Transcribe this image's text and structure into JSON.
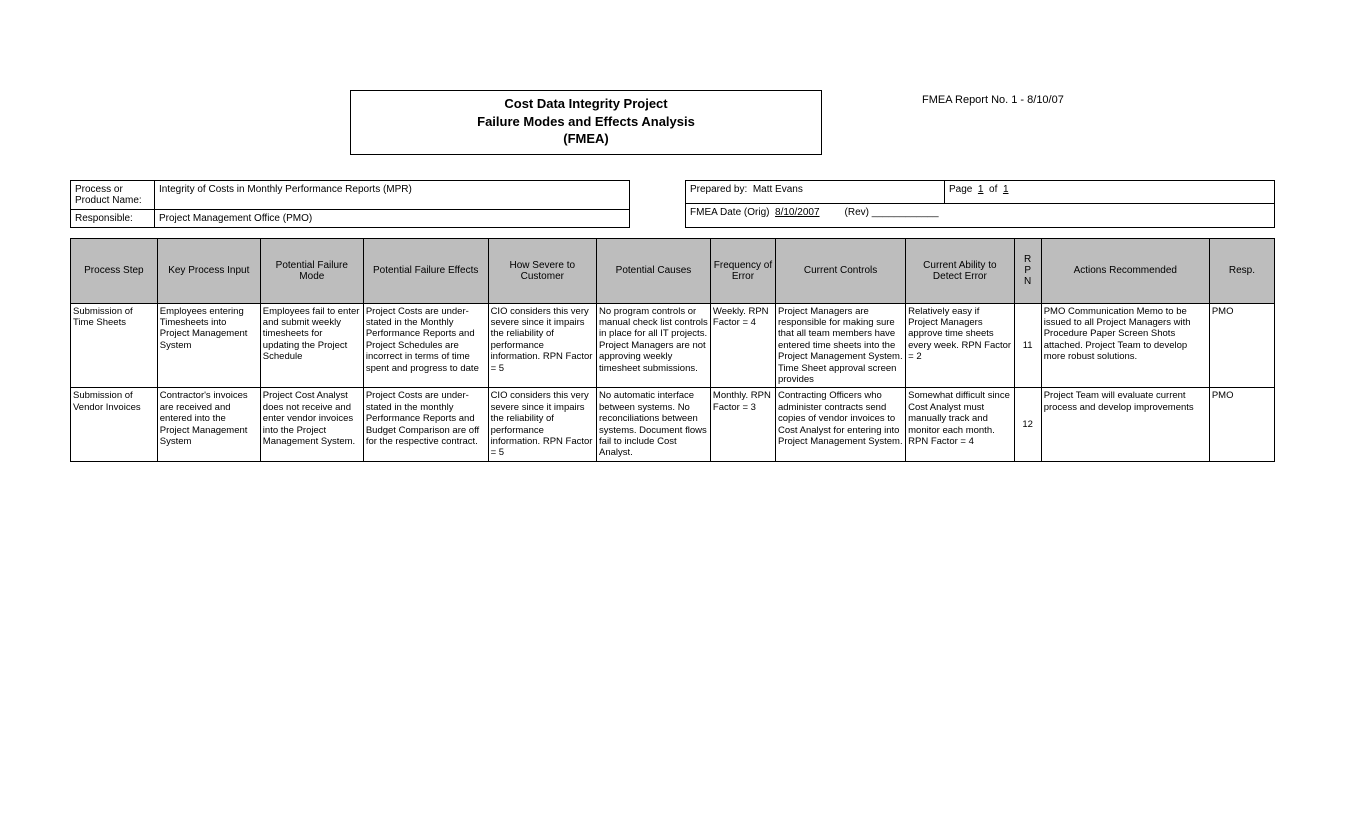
{
  "title": {
    "line1": "Cost Data Integrity Project",
    "line2": "Failure Modes and Effects Analysis",
    "line3": "(FMEA)"
  },
  "report_label": "FMEA Report No. 1 - 8/10/07",
  "meta": {
    "process_label": "Process or Product Name:",
    "process_value": "Integrity of Costs in Monthly Performance Reports (MPR)",
    "responsible_label": "Responsible:",
    "responsible_value": "Project Management Office (PMO)",
    "prepared_by_label": "Prepared by:",
    "prepared_by_value": "Matt Evans",
    "page_label": "Page",
    "page_num": "1",
    "page_of": "of",
    "page_total": "1",
    "fmea_date_label": "FMEA Date (Orig)",
    "fmea_date_value": "8/10/2007",
    "rev_label": "(Rev)",
    "rev_value": "____________"
  },
  "headers": {
    "process_step": "Process Step",
    "key_input": "Key Process Input",
    "failure_mode": "Potential Failure Mode",
    "failure_effects": "Potential Failure Effects",
    "severe": "How Severe to Customer",
    "causes": "Potential Causes",
    "frequency": "Frequency of Error",
    "controls": "Current Controls",
    "detect": "Current Ability to Detect Error",
    "rpn": "R\nP\nN",
    "actions": "Actions Recommended",
    "resp": "Resp."
  },
  "rows": [
    {
      "process_step": "Submission of Time Sheets",
      "key_input": "Employees entering Timesheets into Project Management System",
      "failure_mode": "Employees fail to enter and submit weekly timesheets for updating the Project Schedule",
      "failure_effects": "Project Costs are under-stated in the Monthly Performance Reports and\nProject Schedules are incorrect in terms of time spent and progress to date",
      "severe": "CIO considers this very severe since it impairs the reliability of performance information. RPN Factor = 5",
      "causes": "No program controls or manual check list controls in place for all IT projects. Project Managers are not approving weekly timesheet submissions.",
      "frequency": "Weekly. RPN Factor = 4",
      "controls": "Project Managers are responsible for making sure that all team members have entered time sheets into the Project Management System. Time Sheet approval screen provides",
      "detect": "Relatively easy if Project Managers approve time sheets every week. RPN Factor = 2",
      "rpn": "11",
      "actions": "PMO Communication Memo to be issued to all Project Managers with Procedure Paper Screen Shots attached. Project Team to develop more robust solutions.",
      "resp": "PMO"
    },
    {
      "process_step": "Submission of Vendor Invoices",
      "key_input": "Contractor's invoices are received and entered into the Project Management System",
      "failure_mode": "Project Cost Analyst does not receive and enter vendor invoices into the Project Management System.",
      "failure_effects": "Project Costs are under-stated in the monthly Performance Reports and Budget Comparison are off for the respective contract.",
      "severe": "CIO considers this very severe since it impairs the reliability of performance information. RPN Factor = 5",
      "causes": "No automatic interface between systems. No reconciliations between systems. Document flows fail to include Cost Analyst.",
      "frequency": "Monthly. RPN Factor = 3",
      "controls": "Contracting Officers who administer contracts send copies of vendor invoices to Cost Analyst for entering into Project Management System.",
      "detect": "Somewhat difficult since Cost Analyst must manually track and monitor each month. RPN Factor = 4",
      "rpn": "12",
      "actions": "Project Team will evaluate current process and develop improvements",
      "resp": "PMO"
    }
  ]
}
